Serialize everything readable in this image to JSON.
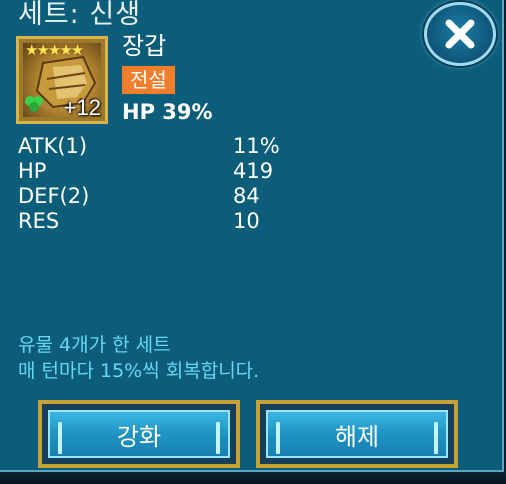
{
  "dialog": {
    "title": "세트: 신생"
  },
  "item": {
    "name": "장갑",
    "rarity": "전설",
    "stars": "★★★★★",
    "level": "+12",
    "main_stat": "HP 39%"
  },
  "stats": [
    {
      "name": "ATK(1)",
      "value": "11%"
    },
    {
      "name": "HP",
      "value": "419"
    },
    {
      "name": "DEF(2)",
      "value": "84"
    },
    {
      "name": "RES",
      "value": "10"
    }
  ],
  "set_description": {
    "line1": "유물 4개가 한 세트",
    "line2": "매 턴마다 15%씩 회복합니다."
  },
  "buttons": {
    "enhance": "강화",
    "unequip": "해제"
  },
  "colors": {
    "panel": "#0c5d79",
    "rarity_badge": "#f07e2c",
    "set_text": "#66d6f3",
    "button_border": "#c7a037"
  }
}
